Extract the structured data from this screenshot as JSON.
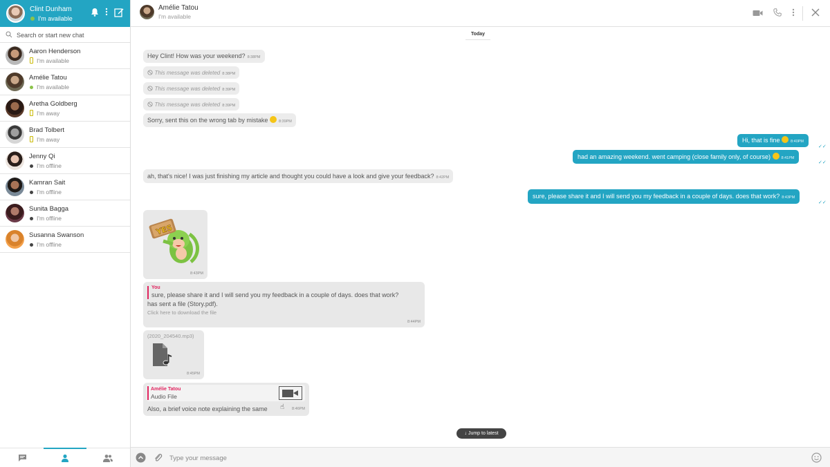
{
  "me": {
    "name": "Clint Dunham",
    "status": "I'm available"
  },
  "search": {
    "placeholder": "Search or start new chat"
  },
  "contacts": [
    {
      "name": "Aaron Henderson",
      "status": "I'm available",
      "presence": "mobile",
      "color": "#c9b800"
    },
    {
      "name": "Amélie Tatou",
      "status": "I'm available",
      "presence": "online",
      "color": "#8bc34a"
    },
    {
      "name": "Aretha Goldberg",
      "status": "I'm away",
      "presence": "mobile",
      "color": "#c9b800"
    },
    {
      "name": "Brad Tolbert",
      "status": "I'm away",
      "presence": "mobile",
      "color": "#c9b800"
    },
    {
      "name": "Jenny Qi",
      "status": "I'm offline",
      "presence": "offline",
      "color": "#444444"
    },
    {
      "name": "Kamran Sait",
      "status": "I'm offline",
      "presence": "offline",
      "color": "#444444"
    },
    {
      "name": "Sunita Bagga",
      "status": "I'm offline",
      "presence": "offline",
      "color": "#444444"
    },
    {
      "name": "Susanna Swanson",
      "status": "I'm offline",
      "presence": "offline",
      "color": "#444444"
    }
  ],
  "chat": {
    "name": "Amélie Tatou",
    "status": "I'm available"
  },
  "day_separator": "Today",
  "messages": {
    "m1": {
      "text": "Hey Clint! How was your weekend?",
      "time": "8:38PM"
    },
    "d1": {
      "text": "This message was deleted",
      "time": "8:38PM"
    },
    "d2": {
      "text": "This message was deleted",
      "time": "8:39PM"
    },
    "d3": {
      "text": "This message was deleted",
      "time": "8:39PM"
    },
    "m2": {
      "text": "Sorry, sent this on the wrong tab by mistake",
      "time": "8:39PM"
    },
    "o1": {
      "text": "Hi, that is fine",
      "time": "8:40PM"
    },
    "o2": {
      "text": "had an amazing weekend. went camping (close family only, of course)",
      "time": "8:41PM"
    },
    "m3": {
      "text": "ah, that's nice! I was just finishing my article and thought you could have a look and give your feedback?",
      "time": "8:42PM"
    },
    "o3": {
      "text": "sure, please share it and I will send you my feedback in a couple of days. does that work?",
      "time": "8:43PM"
    },
    "sticker": {
      "label": "YES",
      "time": "8:43PM"
    },
    "file": {
      "reply_author": "You",
      "reply_text": "sure, please share it and I will send you my feedback in a couple of days. does that work?",
      "text": "has sent a file (Story.pdf).",
      "hint": "Click here to download the file",
      "time": "8:44PM"
    },
    "audio": {
      "name": "(2020_204540.mp3)",
      "time": "8:45PM"
    },
    "voice": {
      "reply_author": "Amélie Tatou",
      "reply_text": "Audio File",
      "text": "Also, a brief voice note explaining the same",
      "time": "8:46PM"
    }
  },
  "jump_label": "Jump to latest",
  "composer": {
    "placeholder": "Type your message"
  },
  "colors": {
    "accent": "#23a5c3",
    "reply_accent": "#e0245e",
    "bubble_in": "#ececec"
  }
}
